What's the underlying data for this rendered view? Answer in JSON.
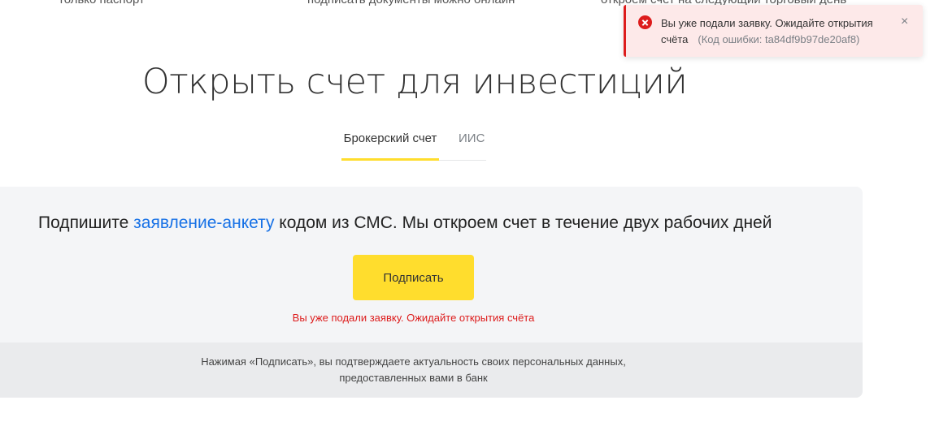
{
  "features": {
    "item1": "только паспорт",
    "item2": "подписать документы можно онлайн",
    "item3": "откроем счет на следующий торговый день"
  },
  "page_title": "Открыть счет для инвестиций",
  "tabs": [
    {
      "label": "Брокерский счет",
      "active": true
    },
    {
      "label": "ИИС",
      "active": false
    }
  ],
  "card": {
    "heading_prefix": "Подпишите ",
    "heading_link": "заявление-анкету",
    "heading_suffix": " кодом из СМС. Мы откроем счет в течение двух рабочих дней",
    "sign_button": "Подписать",
    "error_text": "Вы уже подали заявку. Ожидайте открытия счёта",
    "footer_line1": "Нажимая «Подписать», вы подтверждаете актуальность своих персональных данных,",
    "footer_line2": "предоставленных вами в банк"
  },
  "toast": {
    "message": "Вы уже подали заявку. Ожидайте открытия счёта",
    "code": "(Код ошибки: ta84df9b97de20af8)",
    "close_symbol": "×"
  },
  "colors": {
    "accent_yellow": "#ffdd2d",
    "link_blue": "#1771e6",
    "error_red": "#dd1c1c",
    "toast_bg": "#fde9e9"
  }
}
